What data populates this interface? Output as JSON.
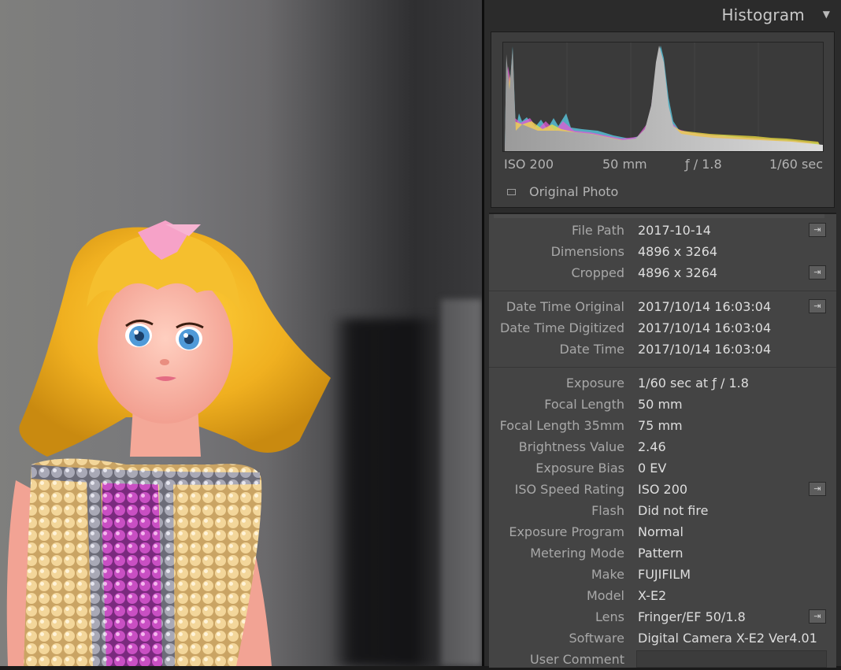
{
  "histogram": {
    "title": "Histogram",
    "toggle_icon": "triangle-down-icon",
    "iso": "ISO 200",
    "focal": "50 mm",
    "aperture": "ƒ / 1.8",
    "shutter": "1/60 sec",
    "original_photo_label": "Original Photo"
  },
  "metadata": {
    "rows": [
      {
        "label": "File Path",
        "value": "2017-10-14"
      },
      {
        "label": "Dimensions",
        "value": "4896 x 3264"
      },
      {
        "label": "Cropped",
        "value": "4896 x 3264"
      },
      {
        "label": "Date Time Original",
        "value": "2017/10/14 16:03:04"
      },
      {
        "label": "Date Time Digitized",
        "value": "2017/10/14 16:03:04"
      },
      {
        "label": "Date Time",
        "value": "2017/10/14 16:03:04"
      },
      {
        "label": "Exposure",
        "value": "1/60 sec at ƒ / 1.8"
      },
      {
        "label": "Focal Length",
        "value": "50 mm"
      },
      {
        "label": "Focal Length 35mm",
        "value": "75 mm"
      },
      {
        "label": "Brightness Value",
        "value": "2.46"
      },
      {
        "label": "Exposure Bias",
        "value": "0 EV"
      },
      {
        "label": "ISO Speed Rating",
        "value": "ISO 200"
      },
      {
        "label": "Flash",
        "value": "Did not fire"
      },
      {
        "label": "Exposure Program",
        "value": "Normal"
      },
      {
        "label": "Metering Mode",
        "value": "Pattern"
      },
      {
        "label": "Make",
        "value": "FUJIFILM"
      },
      {
        "label": "Model",
        "value": "X-E2"
      },
      {
        "label": "Lens",
        "value": "Fringer/EF 50/1.8"
      },
      {
        "label": "Software",
        "value": "Digital Camera X-E2 Ver4.01"
      },
      {
        "label": "User Comment",
        "value": ""
      }
    ],
    "go_button_icon": "arrow-right-icon"
  }
}
